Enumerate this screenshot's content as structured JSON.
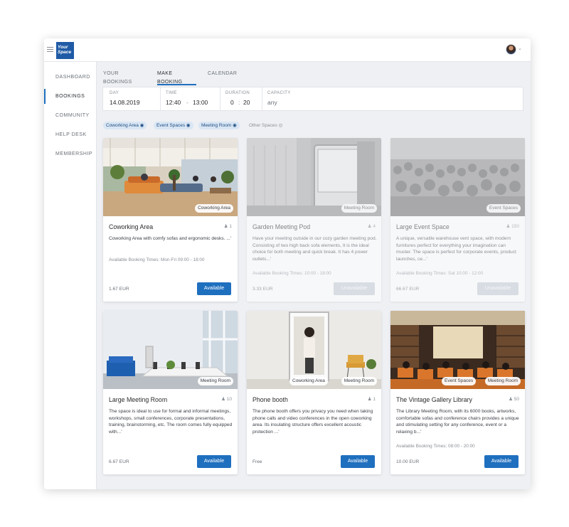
{
  "app": {
    "logo_text": "Your Space"
  },
  "sidebar": {
    "items": [
      {
        "label": "DASHBOARD"
      },
      {
        "label": "BOOKINGS"
      },
      {
        "label": "COMMUNITY"
      },
      {
        "label": "HELP DESK"
      },
      {
        "label": "MEMBERSHIP"
      }
    ]
  },
  "tabs": [
    {
      "label": "YOUR BOOKINGS"
    },
    {
      "label": "MAKE BOOKING"
    },
    {
      "label": "CALENDAR"
    }
  ],
  "filters": {
    "day": {
      "label": "DAY",
      "value": "14.08.2019"
    },
    "time": {
      "label": "TIME",
      "from": "12:40",
      "sep": "-",
      "to": "13:00"
    },
    "duration": {
      "label": "DURATION",
      "hours": "0",
      "sep": ":",
      "minutes": "20"
    },
    "capacity": {
      "label": "CAPACITY",
      "value": "any"
    }
  },
  "chips": [
    {
      "label": "Coworking Area",
      "icon": "eye-icon",
      "active": true
    },
    {
      "label": "Event Spaces",
      "icon": "eye-icon",
      "active": true
    },
    {
      "label": "Meeting Room",
      "icon": "eye-icon",
      "active": true
    },
    {
      "label": "Other Spaces",
      "icon": "eye-icon",
      "active": false
    }
  ],
  "cards": [
    {
      "title": "Coworking Area",
      "capacity": "1",
      "tags": [
        "Coworking Area"
      ],
      "description": "Coworking Area with comfy sofas and ergonomic desks. ...'",
      "times": "Available Booking Times: Mon-Fri 09:00 - 18:00",
      "price": "1.67 EUR",
      "button": "Available",
      "available": true
    },
    {
      "title": "Garden Meeting Pod",
      "capacity": "4",
      "tags": [
        "Meeting Room"
      ],
      "description": "Have your meeting outside in our cozy garden meeting pod. Consisting of two high back sofa elements, It is the ideal choice for both meeting and quick break. It has 4 power outlets...'",
      "times": "Available Booking Times: 10:00 - 18:00",
      "price": "3.33 EUR",
      "button": "Unavailable",
      "available": false
    },
    {
      "title": "Large Event Space",
      "capacity": "150",
      "tags": [
        "Event Spaces"
      ],
      "description": "A unique, versatile warehouse vent space, with modern furnitures perfect for everything your imagination can muster. The space is perfect for corporate events, product launches, ce...'",
      "times": "Available Booking Times: Sat 10:00 - 12:00",
      "price": "66.67 EUR",
      "button": "Unavailable",
      "available": false
    },
    {
      "title": "Large Meeting Room",
      "capacity": "10",
      "tags": [
        "Meeting Room"
      ],
      "description": "The space is ideal to use for formal and informal meetings, workshops, small conferences, corporate presentations, training, brainstorming, etc. The room comes fully equipped with...'",
      "times": "",
      "price": "6.67 EUR",
      "button": "Available",
      "available": true
    },
    {
      "title": "Phone booth",
      "capacity": "1",
      "tags": [
        "Coworking Area",
        "Meeting Room"
      ],
      "description": "The phone booth offers you privacy you need when taking phone calls and video conferences in the open coworking area. Its insulating structure offers excellent acoustic protection ...'",
      "times": "",
      "price": "Free",
      "button": "Available",
      "available": true
    },
    {
      "title": "The Vintage Gallery Library",
      "capacity": "50",
      "tags": [
        "Event Spaces",
        "Meeting Room"
      ],
      "description": "The Library Meeting Room, with its 6000 books, artworks, comfortable sofas and conference chairs provides a unique and stimulating setting for any conference, event or a relaxing b...'",
      "times": "Available Booking Times: 08:00 - 20:00",
      "price": "10.00 EUR",
      "button": "Available",
      "available": true
    }
  ]
}
